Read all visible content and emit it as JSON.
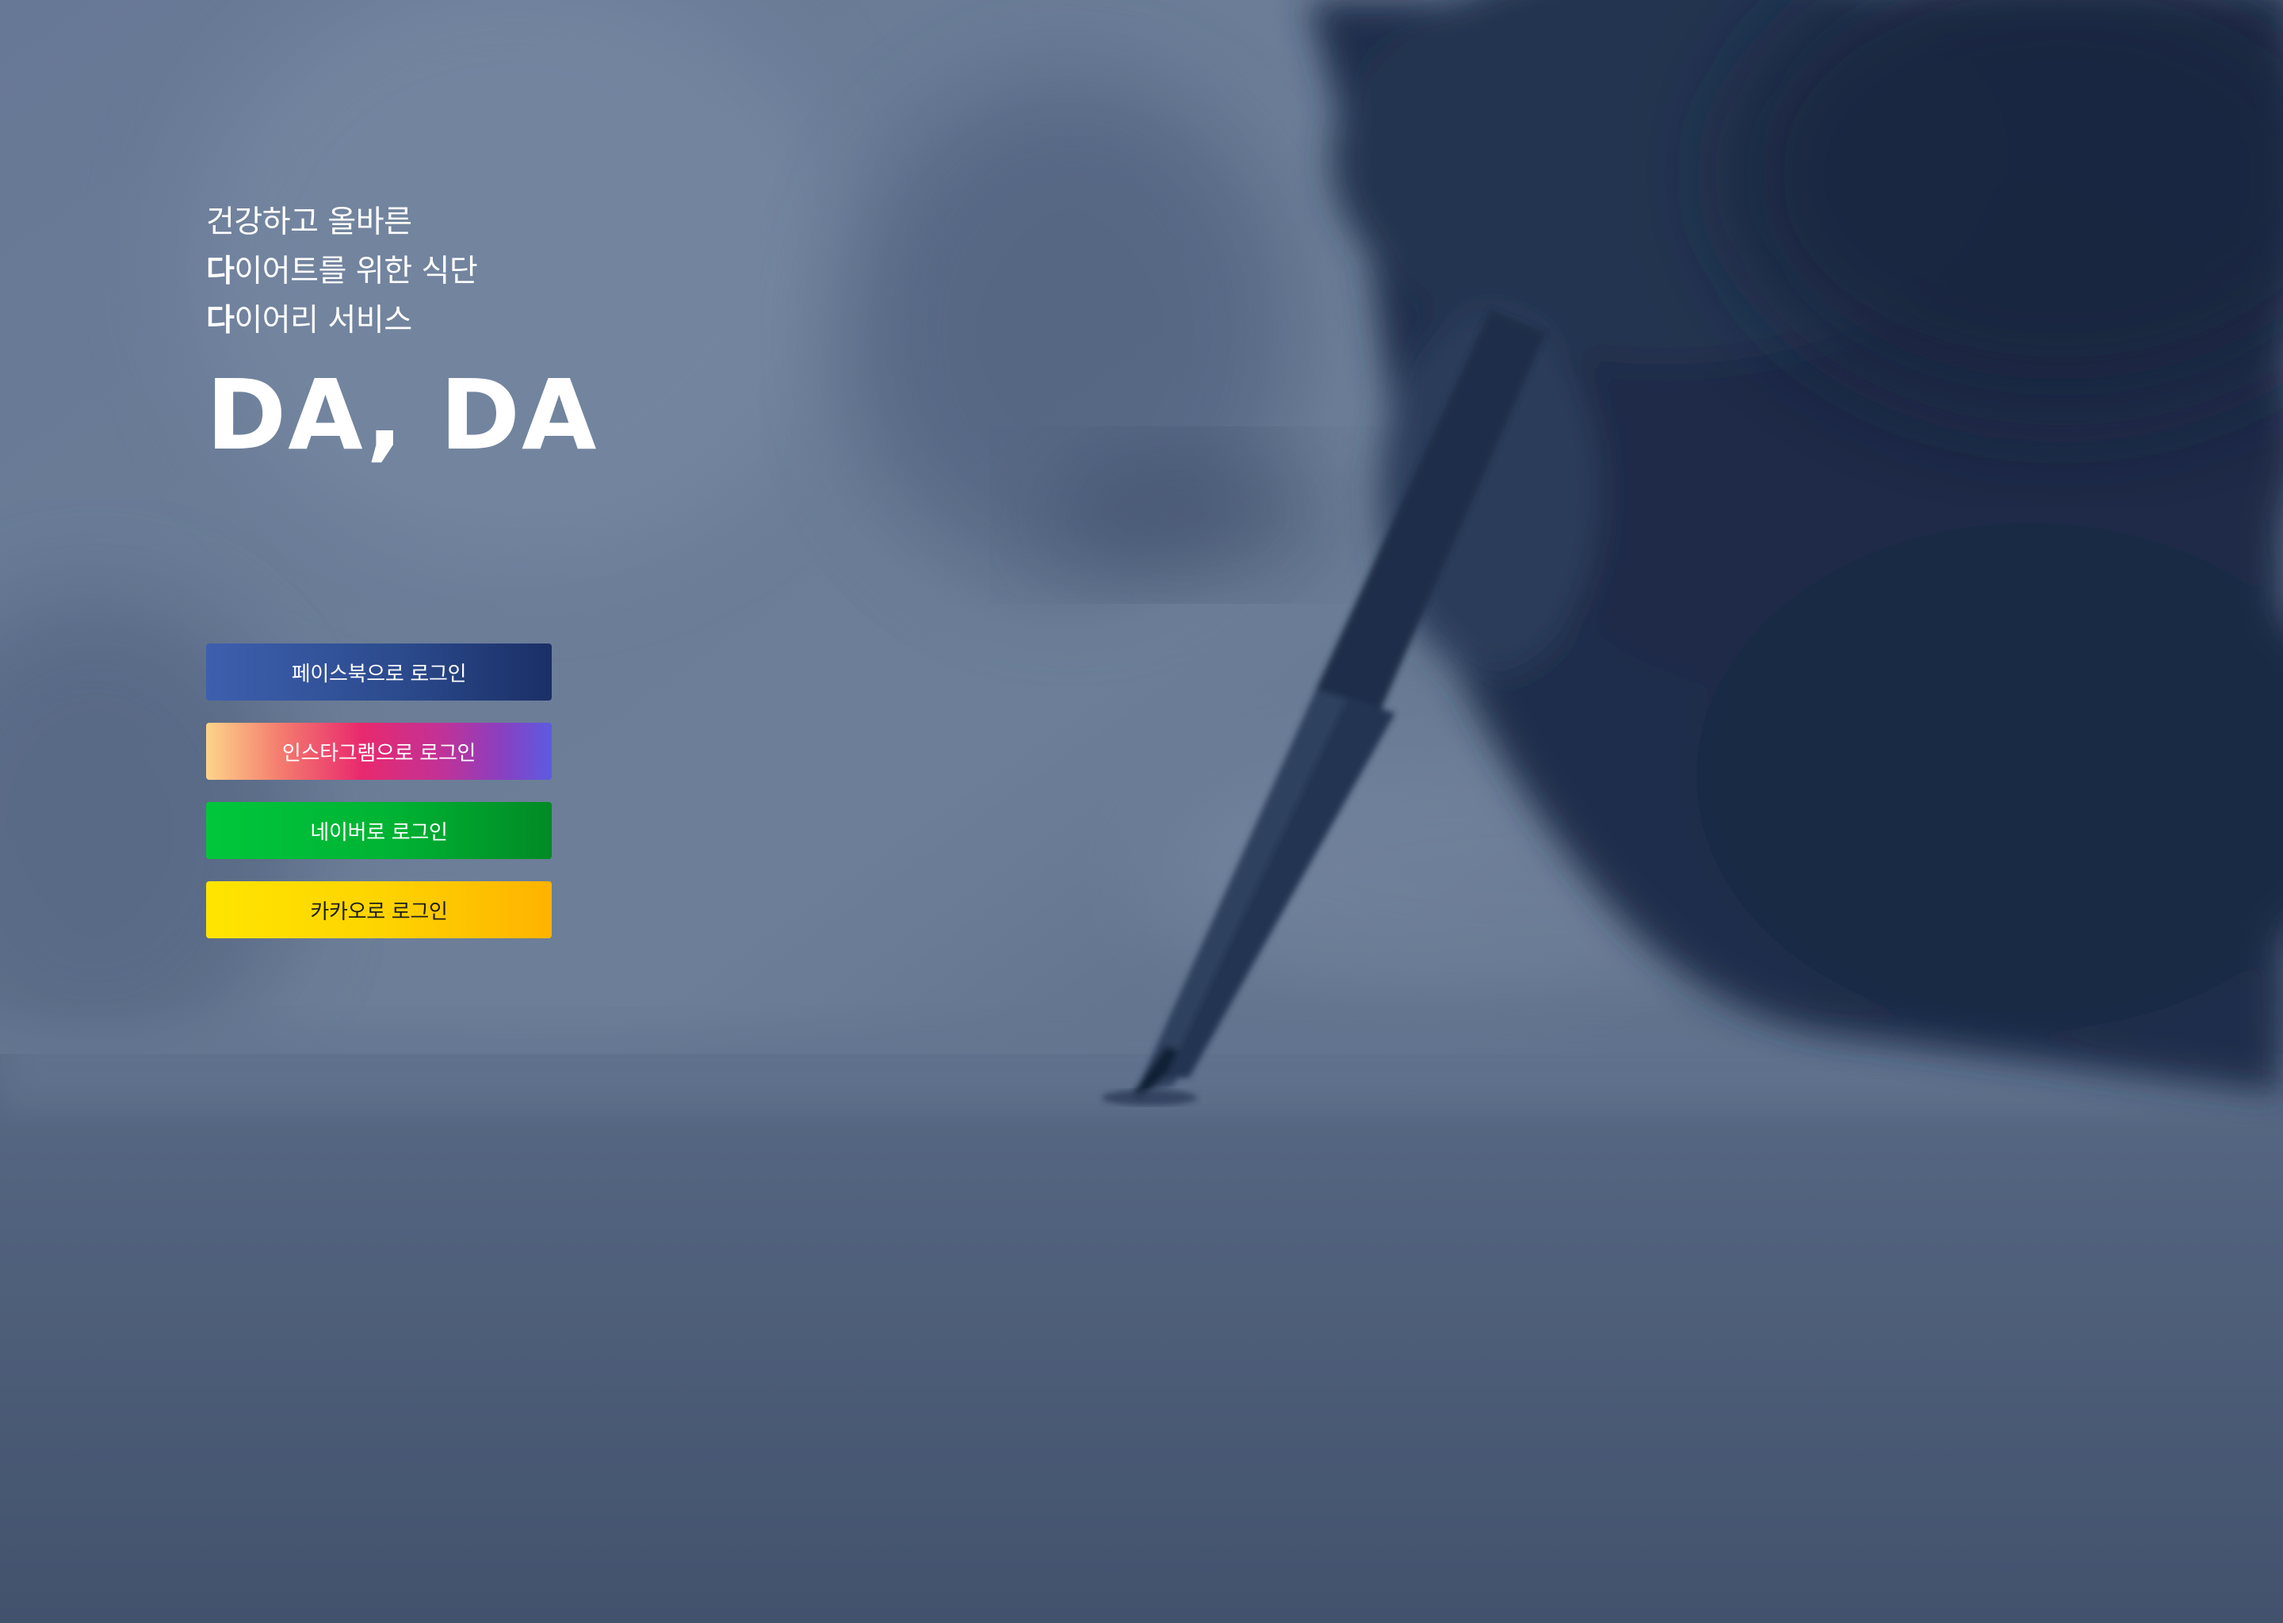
{
  "hero": {
    "tagline": {
      "line1": "건강하고 올바른",
      "line2_bold": "다",
      "line2_rest": "이어트를 위한 식단",
      "line3_bold": "다",
      "line3_rest": "이어리 서비스"
    },
    "brand_title": "DA, DA"
  },
  "login_buttons": [
    {
      "id": "facebook",
      "label": "페이스북으로 로그인"
    },
    {
      "id": "instagram",
      "label": "인스타그램으로 로그인"
    },
    {
      "id": "naver",
      "label": "네이버로 로그인"
    },
    {
      "id": "kakao",
      "label": "카카오로 로그인"
    }
  ],
  "colors": {
    "background_tint": "#5f7190",
    "facebook": "#2c4b8e",
    "instagram_start": "#fdd48a",
    "instagram_end": "#5c5be0",
    "naver": "#00b233",
    "kakao": "#fed400"
  }
}
